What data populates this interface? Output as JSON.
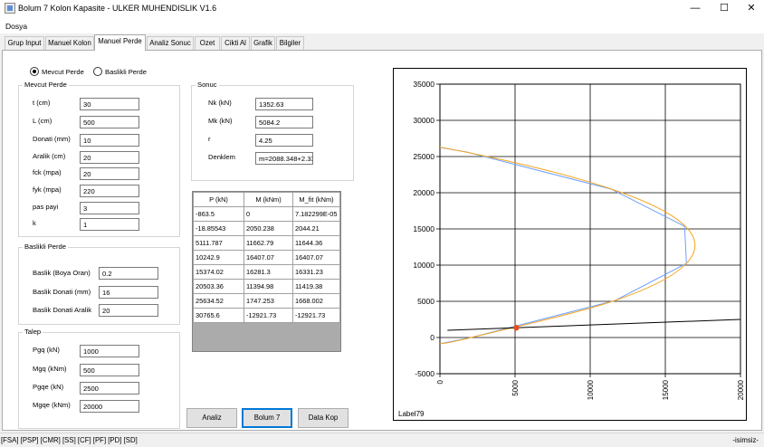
{
  "window": {
    "title": "Bolum 7 Kolon Kapasite - ULKER MUHENDISLIK V1.6",
    "minimize_glyph": "—",
    "maximize_glyph": "☐",
    "close_glyph": "✕"
  },
  "menu": {
    "dosya": "Dosya"
  },
  "tabs": [
    "Grup Input",
    "Manuel Kolon",
    "Manuel Perde",
    "Analiz Sonuc",
    "Ozet",
    "Cikti Al",
    "Grafik",
    "Bilgiler"
  ],
  "wall_type": {
    "mevcut": "Mevcut Perde",
    "baslikli": "Baslikli Perde",
    "selected": "Mevcut Perde"
  },
  "mevcut_perde": {
    "title": "Mevcut Perde",
    "fields": [
      {
        "label": "t (cm)",
        "value": "30"
      },
      {
        "label": "L (cm)",
        "value": "500"
      },
      {
        "label": "Donati (mm)",
        "value": "10"
      },
      {
        "label": "Aralik (cm)",
        "value": "20"
      },
      {
        "label": "fck (mpa)",
        "value": "20"
      },
      {
        "label": "fyk (mpa)",
        "value": "220"
      },
      {
        "label": "pas payi",
        "value": "3"
      },
      {
        "label": "k",
        "value": "1"
      }
    ]
  },
  "baslikli_perde": {
    "title": "Baslikli Perde",
    "fields": [
      {
        "label": "Baslik (Boya Oran)",
        "value": "0.2"
      },
      {
        "label": "Baslik Donati (mm)",
        "value": "16"
      },
      {
        "label": "Baslik Donati Aralik",
        "value": "20"
      }
    ]
  },
  "talep": {
    "title": "Talep",
    "fields": [
      {
        "label": "Pgq (kN)",
        "value": "1000"
      },
      {
        "label": "Mgq (kNm)",
        "value": "500"
      },
      {
        "label": "Pgqe (kN)",
        "value": "2500"
      },
      {
        "label": "Mgqe (kNm)",
        "value": "20000"
      }
    ]
  },
  "sonuc": {
    "title": "Sonuc",
    "fields": [
      {
        "label": "Nk (kN)",
        "value": "1352.63"
      },
      {
        "label": "Mk (kN)",
        "value": "5084.2"
      },
      {
        "label": "r",
        "value": "4.25"
      },
      {
        "label": "Denklem",
        "value": "m=2088.348+2.33"
      }
    ]
  },
  "grid": {
    "headers": [
      "P (kN)",
      "M (kNm)",
      "M_fit (kNm)"
    ],
    "rows": [
      [
        "-863.5",
        "0",
        "7.182299E-05"
      ],
      [
        "-18.85543",
        "2050.238",
        "2044.21"
      ],
      [
        "5111.787",
        "11662.79",
        "11644.36"
      ],
      [
        "10242.9",
        "16407.07",
        "16407.07"
      ],
      [
        "15374.02",
        "16281.3",
        "16331.23"
      ],
      [
        "20503.36",
        "11394.98",
        "11419.38"
      ],
      [
        "25634.52",
        "1747.253",
        "1668.002"
      ],
      [
        "30765.6",
        "-12921.73",
        "-12921.73"
      ]
    ]
  },
  "buttons": {
    "analiz": "Analiz",
    "bolum7": "Bolum 7",
    "data_kop": "Data Kop"
  },
  "chart_data": {
    "type": "line",
    "title": "",
    "xlabel": "",
    "ylabel": "",
    "xlim": [
      0,
      20000
    ],
    "ylim": [
      -5000,
      35000
    ],
    "x_ticks": [
      0,
      5000,
      10000,
      15000,
      20000
    ],
    "y_ticks": [
      -5000,
      0,
      5000,
      10000,
      15000,
      20000,
      25000,
      30000,
      35000
    ],
    "x_tick_labels": [
      "0",
      "5000",
      "10000",
      "15000",
      "20000"
    ],
    "y_tick_labels": [
      "-5000",
      "0",
      "5000",
      "10000",
      "15000",
      "20000",
      "25000",
      "30000",
      "35000"
    ],
    "grid": true,
    "series": [
      {
        "color": "#6fa0ff",
        "points": [
          [
            0,
            -863.5
          ],
          [
            2050.238,
            -18.85543
          ],
          [
            11662.79,
            5111.787
          ],
          [
            16407.07,
            10242.9
          ],
          [
            16281.3,
            15374.02
          ],
          [
            11394.98,
            20503.36
          ],
          [
            1747.253,
            25634.52
          ],
          [
            -12921.73,
            30765.6
          ]
        ]
      },
      {
        "color": "#f5a623",
        "smooth": true,
        "points": [
          [
            0,
            -863.5
          ],
          [
            2044.21,
            -18.85543
          ],
          [
            11644.36,
            5111.787
          ],
          [
            16407.07,
            10242.9
          ],
          [
            16331.23,
            15374.02
          ],
          [
            11419.38,
            20503.36
          ],
          [
            1668.002,
            25634.52
          ],
          [
            -12921.73,
            30765.6
          ]
        ]
      },
      {
        "color": "#000000",
        "points": [
          [
            500,
            1000
          ],
          [
            20000,
            2500
          ]
        ]
      }
    ],
    "marker": {
      "x": 5084.2,
      "y": 1352.63,
      "color": "#e05020"
    },
    "label": "Label79"
  },
  "status": {
    "left": "[FSA]  [PSP]  [CMR]  [SS]  [CF]  [PF]  [PD]  [SD]",
    "right": "-isimsiz-"
  }
}
